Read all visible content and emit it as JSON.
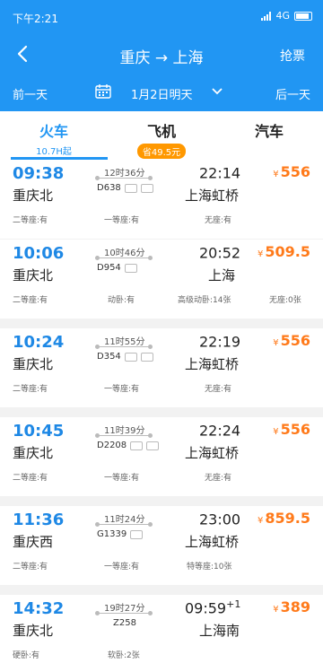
{
  "status": {
    "time": "下午2:21",
    "network": "4G"
  },
  "nav": {
    "title": "重庆 → 上海",
    "grab": "抢票"
  },
  "datebar": {
    "prev": "前一天",
    "date": "1月2日明天",
    "next": "后一天"
  },
  "tabs": [
    {
      "label": "火车",
      "sub": "10.7H起"
    },
    {
      "label": "飞机",
      "sub": "省49.5元"
    },
    {
      "label": "汽车",
      "sub": ""
    }
  ],
  "trains": [
    {
      "dep": "09:38",
      "from": "重庆北",
      "dur": "12时36分",
      "no": "D638",
      "arr": "22:14",
      "arr_plus": "",
      "to": "上海虹桥",
      "price": "556",
      "seats": [
        "二等座:有",
        "一等座:有",
        "无座:有",
        ""
      ]
    },
    {
      "dep": "10:06",
      "from": "重庆北",
      "dur": "10时46分",
      "no": "D954",
      "arr": "20:52",
      "arr_plus": "",
      "to": "上海",
      "price": "509.5",
      "seats": [
        "二等座:有",
        "动卧:有",
        "高级动卧:14张",
        "无座:0张"
      ]
    },
    {
      "dep": "10:24",
      "from": "重庆北",
      "dur": "11时55分",
      "no": "D354",
      "arr": "22:19",
      "arr_plus": "",
      "to": "上海虹桥",
      "price": "556",
      "seats": [
        "二等座:有",
        "一等座:有",
        "无座:有",
        ""
      ]
    },
    {
      "dep": "10:45",
      "from": "重庆北",
      "dur": "11时39分",
      "no": "D2208",
      "arr": "22:24",
      "arr_plus": "",
      "to": "上海虹桥",
      "price": "556",
      "seats": [
        "二等座:有",
        "一等座:有",
        "无座:有",
        ""
      ]
    },
    {
      "dep": "11:36",
      "from": "重庆西",
      "dur": "11时24分",
      "no": "G1339",
      "arr": "23:00",
      "arr_plus": "",
      "to": "上海虹桥",
      "price": "859.5",
      "seats": [
        "二等座:有",
        "一等座:有",
        "特等座:10张",
        ""
      ]
    },
    {
      "dep": "14:32",
      "from": "重庆北",
      "dur": "19时27分",
      "no": "Z258",
      "arr": "09:59",
      "arr_plus": "+1",
      "to": "上海南",
      "price": "389",
      "seats": [
        "硬卧:有",
        "软卧:2张",
        "",
        ""
      ]
    }
  ],
  "currency": "¥",
  "colors": {
    "primary": "#2196f3",
    "price": "#ff7a1a",
    "badge": "#ff9800"
  }
}
